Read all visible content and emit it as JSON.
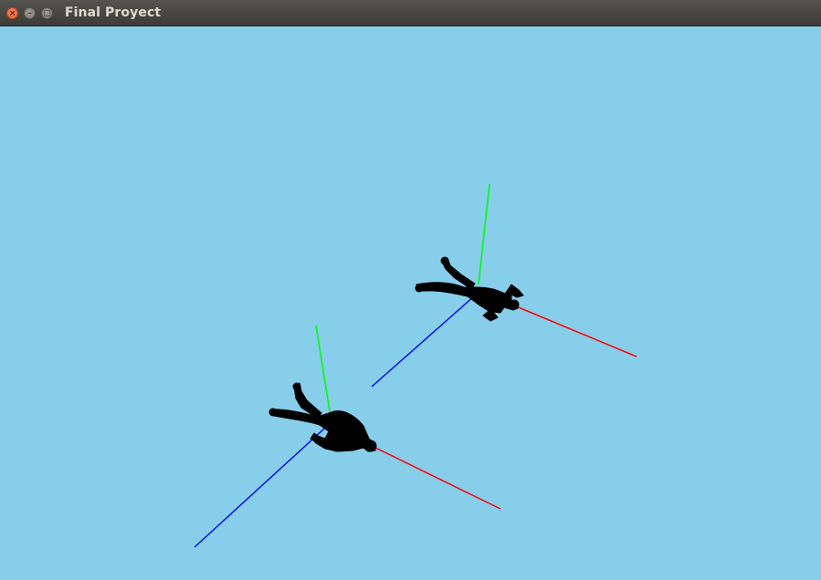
{
  "window": {
    "title": "Final Proyect",
    "controls": {
      "close_glyph": "×",
      "minimize_glyph": "–",
      "maximize_glyph": "□"
    }
  },
  "scene": {
    "background_color": "#87ceeb",
    "figure_color": "#000000",
    "axis_colors": {
      "x": "#ff0000",
      "y": "#00ff00",
      "z": "#0000ff"
    },
    "figures_count": 2
  }
}
